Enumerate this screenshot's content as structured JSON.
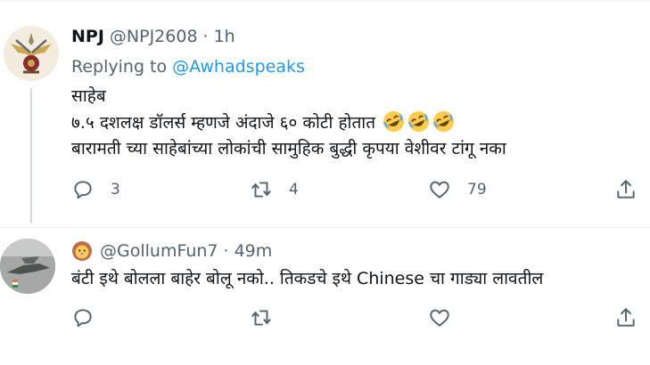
{
  "tweets": [
    {
      "name": "NPJ",
      "handle": "@NPJ2608",
      "separator": "·",
      "time": "1h",
      "replying_prefix": "Replying to ",
      "replying_to": "@Awhadspeaks",
      "lines": [
        "साहेब",
        "७.५ दशलक्ष डॉलर्स म्हणजे अंदाजे ६० कोटी होतात",
        "बारामती च्या साहेबांच्या लोकांची सामुहिक बुद्धी कृपया वेशीवर टांगू नका"
      ],
      "emoji": "rolling-on-floor-laughing-emoji x3",
      "replies": "3",
      "retweets": "4",
      "likes": "79"
    },
    {
      "handle": "@GollumFun7",
      "separator": "·",
      "time": "49m",
      "name_emoji": "lion-face-emoji",
      "text": "बंटी इथे बोलला बाहेर बोलू नको.. तिकडचे इथे Chinese चा गाड्या लावतील"
    }
  ],
  "colors": {
    "link": "#1d9bf0",
    "secondary": "#536471",
    "text": "#0f1419",
    "thread_line": "#cfd9de"
  },
  "icons": [
    "reply-icon",
    "retweet-icon",
    "like-icon",
    "share-icon"
  ]
}
